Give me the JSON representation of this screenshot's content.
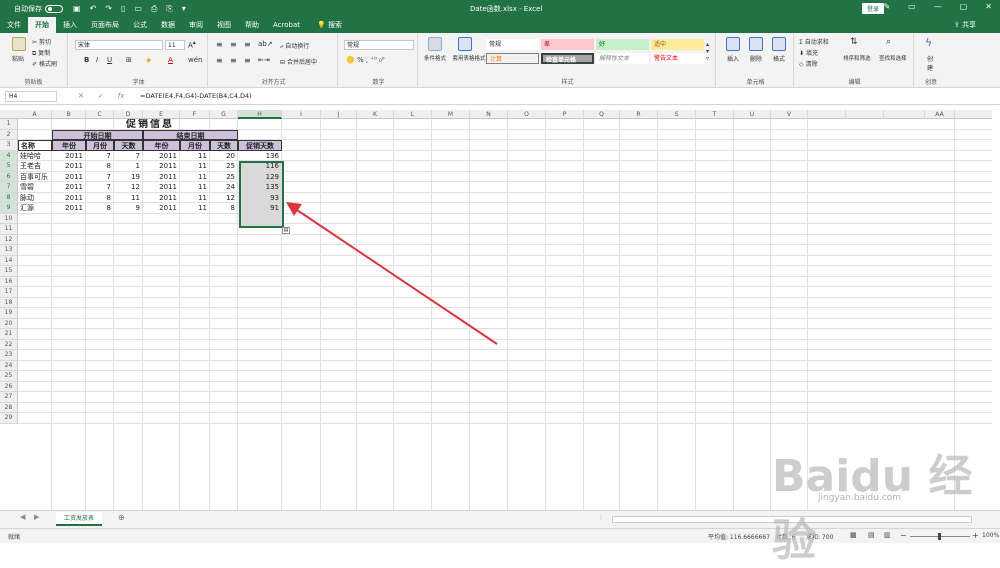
{
  "titlebar": {
    "autosave": "自动保存",
    "autosave_state": "关",
    "doc_title": "Date函数.xlsx  -  Excel",
    "login": "登录"
  },
  "tabs": [
    "文件",
    "开始",
    "插入",
    "页面布局",
    "公式",
    "数据",
    "审阅",
    "视图",
    "帮助",
    "Acrobat"
  ],
  "active_tab": "开始",
  "search": "搜索",
  "share": "共享",
  "ribbon": {
    "clipboard": {
      "label": "剪贴板",
      "paste": "粘贴",
      "cut": "剪切",
      "copy": "复制",
      "format_painter": "格式刷"
    },
    "font": {
      "label": "字体",
      "font_name": "宋体",
      "font_size": "11"
    },
    "alignment": {
      "label": "对齐方式",
      "wrap": "自动换行",
      "merge": "合并后居中"
    },
    "number": {
      "label": "数字",
      "format": "常规"
    },
    "styles": {
      "label": "样式",
      "cond_format": "条件格式",
      "table_format": "套用表格格式",
      "items": [
        {
          "text": "常规",
          "bg": "#ffffff",
          "color": "#222"
        },
        {
          "text": "差",
          "bg": "#ffc7ce",
          "color": "#9c0006"
        },
        {
          "text": "好",
          "bg": "#c6efce",
          "color": "#006100"
        },
        {
          "text": "适中",
          "bg": "#ffeb9c",
          "color": "#9c5700"
        },
        {
          "text": "计算",
          "bg": "#f2f2f2",
          "color": "#fa7d00"
        },
        {
          "text": "检查单元格",
          "bg": "#a5a5a5",
          "color": "#ffffff"
        },
        {
          "text": "解释性文本",
          "bg": "#ffffff",
          "color": "#7f7f7f"
        },
        {
          "text": "警告文本",
          "bg": "#ffffff",
          "color": "#ff0000"
        }
      ]
    },
    "cells": {
      "label": "单元格",
      "insert": "插入",
      "delete": "删除",
      "format": "格式"
    },
    "editing": {
      "label": "编辑",
      "autosum": "自动求和",
      "fill": "填充",
      "clear": "清除",
      "sort": "排序和筛选",
      "find": "查找和选择"
    },
    "create": {
      "label": "创意",
      "create": "创建"
    }
  },
  "formula_bar": {
    "name_box": "H4",
    "formula": "=DATE(E4,F4,G4)-DATE(B4,C4,D4)"
  },
  "columns": [
    "A",
    "B",
    "C",
    "D",
    "E",
    "F",
    "G",
    "H",
    "I",
    "J",
    "K",
    "L",
    "M",
    "N",
    "O",
    "P",
    "Q",
    "R",
    "S",
    "T",
    "U",
    "V",
    "AA"
  ],
  "rows": [
    "1",
    "2",
    "3",
    "4",
    "5",
    "6",
    "7",
    "8",
    "9",
    "10",
    "11",
    "12",
    "13",
    "14",
    "15",
    "16",
    "17",
    "18",
    "19",
    "20",
    "21",
    "22",
    "23",
    "24",
    "25",
    "26",
    "27",
    "28",
    "29"
  ],
  "sheet": {
    "title": "促销信息",
    "start_header": "开始日期",
    "end_header": "结束日期",
    "col_name": "名称",
    "col_year": "年份",
    "col_month": "月份",
    "col_day": "天数",
    "col_promo": "促销天数",
    "data": [
      [
        "娃哈哈",
        "2011",
        "7",
        "7",
        "2011",
        "11",
        "20",
        "136"
      ],
      [
        "王老吉",
        "2011",
        "8",
        "1",
        "2011",
        "11",
        "25",
        "116"
      ],
      [
        "百事可乐",
        "2011",
        "7",
        "19",
        "2011",
        "11",
        "25",
        "129"
      ],
      [
        "雪碧",
        "2011",
        "7",
        "12",
        "2011",
        "11",
        "24",
        "135"
      ],
      [
        "脉动",
        "2011",
        "8",
        "11",
        "2011",
        "11",
        "12",
        "93"
      ],
      [
        "汇源",
        "2011",
        "8",
        "9",
        "2011",
        "11",
        "8",
        "91"
      ]
    ]
  },
  "sheet_tab": "工资发放表",
  "status": {
    "ready": "就绪",
    "average": "平均值: 116.6666667",
    "count": "计数: 6",
    "sum": "求和: 700",
    "zoom": "100%"
  },
  "watermark": {
    "text": "Baidu 经验",
    "sub": "jingyan.baidu.com"
  }
}
